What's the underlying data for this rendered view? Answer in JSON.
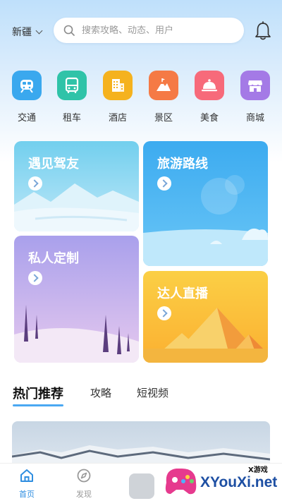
{
  "header": {
    "city": "新疆",
    "search_placeholder": "搜索攻略、动态、用户"
  },
  "categories": [
    {
      "label": "交通",
      "icon": "train-icon",
      "color": "#3aa8ee"
    },
    {
      "label": "租车",
      "icon": "bus-icon",
      "color": "#2fc3a8"
    },
    {
      "label": "酒店",
      "icon": "hotel-icon",
      "color": "#f5b21e"
    },
    {
      "label": "景区",
      "icon": "mountain-icon",
      "color": "#f57a45"
    },
    {
      "label": "美食",
      "icon": "food-cloche-icon",
      "color": "#f76a7a"
    },
    {
      "label": "商城",
      "icon": "shop-icon",
      "color": "#a47ae6"
    }
  ],
  "tiles": {
    "meet_friends": "遇见驾友",
    "travel_routes": "旅游路线",
    "private_custom": "私人定制",
    "expert_live": "达人直播"
  },
  "tabs": [
    "热门推荐",
    "攻略",
    "短视频"
  ],
  "nav": {
    "home": "首页",
    "discover": "发现"
  },
  "watermark": {
    "brand": "XYouXi.net",
    "sub": "X游戏"
  }
}
